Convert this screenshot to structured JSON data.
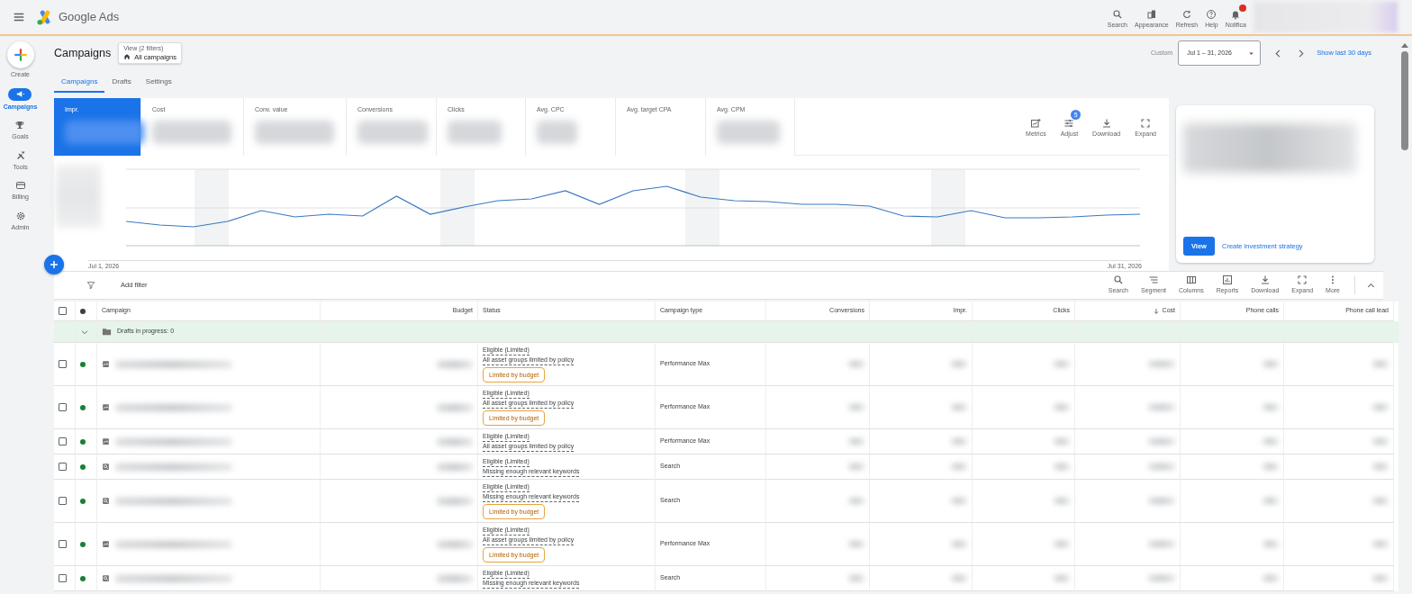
{
  "app": {
    "title": "Google Ads"
  },
  "topbar_actions": [
    {
      "label": "Search",
      "badge": false
    },
    {
      "label": "Appearance",
      "badge": false
    },
    {
      "label": "Refresh",
      "badge": false
    },
    {
      "label": "Help",
      "badge": false
    },
    {
      "label": "Notifica",
      "badge": true
    }
  ],
  "create_button": {
    "label": "Create"
  },
  "rail": [
    {
      "label": "Campaigns",
      "selected": true
    },
    {
      "label": "Goals",
      "selected": false
    },
    {
      "label": "Tools",
      "selected": false
    },
    {
      "label": "Billing",
      "selected": false
    },
    {
      "label": "Admin",
      "selected": false
    }
  ],
  "page": {
    "title": "Campaigns",
    "view_caption": "View (2 filters)",
    "view_value": "All campaigns"
  },
  "date": {
    "prefix": "Custom",
    "range": "Jul 1 – 31, 2026",
    "link": "Show last 30 days"
  },
  "tabs": [
    {
      "label": "Campaigns",
      "selected": true
    },
    {
      "label": "Drafts",
      "selected": false
    },
    {
      "label": "Settings",
      "selected": false
    }
  ],
  "metrics": [
    {
      "label": "Impr.",
      "selected": true
    },
    {
      "label": "Cost",
      "selected": false
    },
    {
      "label": "Conv. value",
      "selected": false
    },
    {
      "label": "Conversions",
      "selected": false
    },
    {
      "label": "Clicks",
      "selected": false
    },
    {
      "label": "Avg. CPC",
      "selected": false
    },
    {
      "label": "Avg. target CPA",
      "selected": false
    },
    {
      "label": "Avg. CPM",
      "selected": false
    }
  ],
  "chart_tools": [
    {
      "label": "Metrics"
    },
    {
      "label": "Adjust",
      "badge": "5"
    },
    {
      "label": "Download"
    },
    {
      "label": "Expand"
    }
  ],
  "chart": {
    "start_label": "Jul 1, 2026",
    "end_label": "Jul 31, 2026"
  },
  "promo": {
    "button": "View",
    "link": "Create investment strategy"
  },
  "filter": {
    "label": "Add filter"
  },
  "table_tools": [
    {
      "label": "Search"
    },
    {
      "label": "Segment"
    },
    {
      "label": "Columns"
    },
    {
      "label": "Reports"
    },
    {
      "label": "Download"
    },
    {
      "label": "Expand"
    },
    {
      "label": "More"
    }
  ],
  "table": {
    "all_checked": false,
    "columns": [
      {
        "label": "Campaign",
        "sorted": false
      },
      {
        "label": "Budget",
        "sorted": false
      },
      {
        "label": "Status",
        "sorted": false
      },
      {
        "label": "Campaign type",
        "sorted": false
      },
      {
        "label": "Conversions",
        "sorted": false
      },
      {
        "label": "Impr.",
        "sorted": false
      },
      {
        "label": "Clicks",
        "sorted": false
      },
      {
        "label": "Cost",
        "sorted": true
      },
      {
        "label": "Phone calls",
        "sorted": false
      },
      {
        "label": "Phone call lead",
        "sorted": false
      }
    ],
    "group_row": {
      "label": "Drafts in progress: 0",
      "expanded": true
    },
    "rows": [
      {
        "kind": "image",
        "checked": false,
        "enabled": true,
        "status": "Eligible (Limited)",
        "reason": "All asset groups limited by policy",
        "badge": "Limited by budget",
        "campaign_type": "Performance Max"
      },
      {
        "kind": "image",
        "checked": false,
        "enabled": true,
        "status": "Eligible (Limited)",
        "reason": "All asset groups limited by policy",
        "badge": "Limited by budget",
        "campaign_type": "Performance Max"
      },
      {
        "kind": "image",
        "checked": false,
        "enabled": true,
        "status": "Eligible (Limited)",
        "reason": "All asset groups limited by policy",
        "campaign_type": "Performance Max"
      },
      {
        "kind": "search",
        "checked": false,
        "enabled": true,
        "status": "Eligible (Limited)",
        "reason": "Missing enough relevant keywords",
        "campaign_type": "Search"
      },
      {
        "kind": "search",
        "checked": false,
        "enabled": true,
        "status": "Eligible (Limited)",
        "reason": "Missing enough relevant keywords",
        "badge": "Limited by budget",
        "campaign_type": "Search"
      },
      {
        "kind": "image",
        "checked": false,
        "enabled": true,
        "status": "Eligible (Limited)",
        "reason": "All asset groups limited by policy",
        "badge": "Limited by budget",
        "campaign_type": "Performance Max"
      },
      {
        "kind": "search",
        "checked": false,
        "enabled": true,
        "status": "Eligible (Limited)",
        "reason": "Missing enough relevant keywords",
        "campaign_type": "Search"
      }
    ]
  }
}
